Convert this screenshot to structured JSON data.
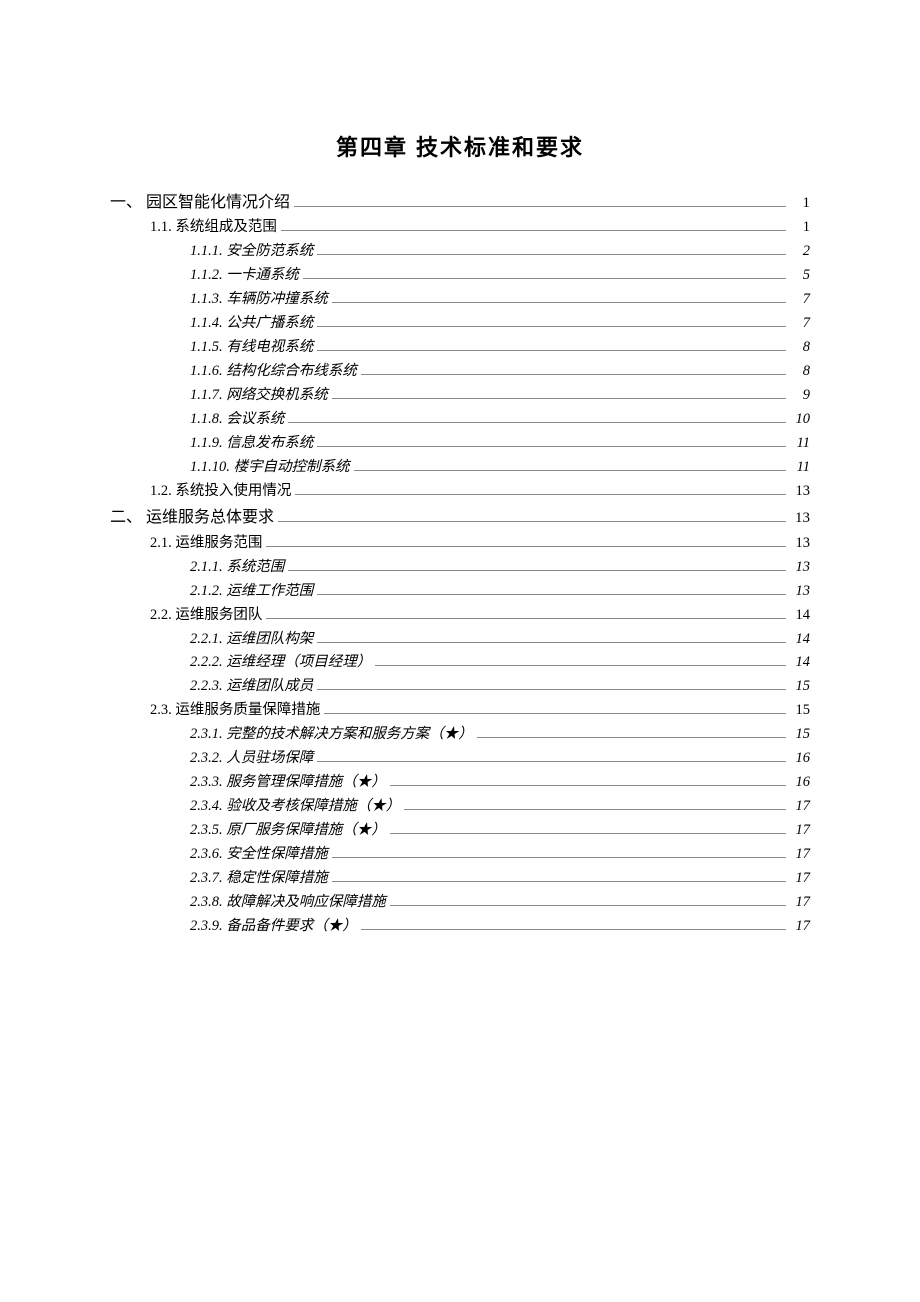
{
  "chapter_title": "第四章   技术标准和要求",
  "toc": [
    {
      "level": 1,
      "label": "一、 园区智能化情况介绍",
      "page": "1"
    },
    {
      "level": 2,
      "label": "1.1. 系统组成及范围",
      "page": "1"
    },
    {
      "level": 3,
      "label": "1.1.1. 安全防范系统",
      "page": "2"
    },
    {
      "level": 3,
      "label": "1.1.2. 一卡通系统",
      "page": "5"
    },
    {
      "level": 3,
      "label": "1.1.3. 车辆防冲撞系统",
      "page": "7"
    },
    {
      "level": 3,
      "label": "1.1.4. 公共广播系统",
      "page": "7"
    },
    {
      "level": 3,
      "label": "1.1.5. 有线电视系统",
      "page": "8"
    },
    {
      "level": 3,
      "label": "1.1.6. 结构化综合布线系统",
      "page": "8"
    },
    {
      "level": 3,
      "label": "1.1.7. 网络交换机系统",
      "page": "9"
    },
    {
      "level": 3,
      "label": "1.1.8. 会议系统",
      "page": "10"
    },
    {
      "level": 3,
      "label": "1.1.9. 信息发布系统",
      "page": "11"
    },
    {
      "level": 3,
      "label": "1.1.10. 楼宇自动控制系统",
      "page": "11"
    },
    {
      "level": 2,
      "label": "1.2. 系统投入使用情况",
      "page": "13"
    },
    {
      "level": 1,
      "label": "二、 运维服务总体要求",
      "page": "13"
    },
    {
      "level": 2,
      "label": "2.1. 运维服务范围",
      "page": "13"
    },
    {
      "level": 3,
      "label": "2.1.1. 系统范围",
      "page": "13"
    },
    {
      "level": 3,
      "label": "2.1.2. 运维工作范围",
      "page": "13"
    },
    {
      "level": 2,
      "label": "2.2. 运维服务团队",
      "page": "14"
    },
    {
      "level": 3,
      "label": "2.2.1. 运维团队构架",
      "page": "14"
    },
    {
      "level": 3,
      "label": "2.2.2. 运维经理（项目经理）",
      "page": "14"
    },
    {
      "level": 3,
      "label": "2.2.3. 运维团队成员",
      "page": "15"
    },
    {
      "level": 2,
      "label": "2.3. 运维服务质量保障措施",
      "page": "15"
    },
    {
      "level": 3,
      "label": "2.3.1. 完整的技术解决方案和服务方案（★）",
      "page": "15"
    },
    {
      "level": 3,
      "label": "2.3.2. 人员驻场保障",
      "page": "16"
    },
    {
      "level": 3,
      "label": "2.3.3. 服务管理保障措施（★）",
      "page": "16"
    },
    {
      "level": 3,
      "label": "2.3.4. 验收及考核保障措施（★）",
      "page": "17"
    },
    {
      "level": 3,
      "label": "2.3.5. 原厂服务保障措施（★）",
      "page": "17"
    },
    {
      "level": 3,
      "label": "2.3.6. 安全性保障措施",
      "page": "17"
    },
    {
      "level": 3,
      "label": "2.3.7. 稳定性保障措施",
      "page": "17"
    },
    {
      "level": 3,
      "label": "2.3.8. 故障解决及响应保障措施",
      "page": "17"
    },
    {
      "level": 3,
      "label": "2.3.9. 备品备件要求（★）",
      "page": "17"
    }
  ]
}
